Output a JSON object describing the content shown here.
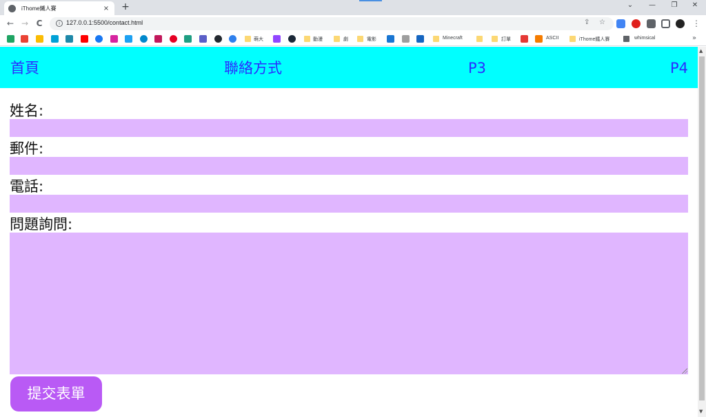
{
  "browser": {
    "tab_title": "iThome鐵人賽",
    "tab_close": "×",
    "new_tab": "+",
    "window_controls": [
      "⌄",
      "—",
      "❐",
      "✕"
    ],
    "nav": {
      "back": "←",
      "forward": "→",
      "reload": "C"
    },
    "url": "127.0.0.1:5500/contact.html",
    "omnibox_icons": [
      "share-icon",
      "star-icon"
    ],
    "menu": "⋮",
    "bookmarks": [
      {
        "label": "萌大"
      },
      {
        "label": "動漫"
      },
      {
        "label": "劇"
      },
      {
        "label": "電影"
      },
      {
        "label": "Minecraft"
      },
      {
        "label": "訂單"
      },
      {
        "label": "ASCII"
      },
      {
        "label": "iThome鐵人賽"
      },
      {
        "label": "whimsical"
      }
    ],
    "bookmarks_more": "»"
  },
  "nav": {
    "home": "首頁",
    "contact": "聯絡方式",
    "p3": "P3",
    "p4": "P4"
  },
  "form": {
    "name_label": "姓名:",
    "email_label": "郵件:",
    "phone_label": "電話:",
    "question_label": "問題詢問:",
    "name_value": "",
    "email_value": "",
    "phone_value": "",
    "question_value": "",
    "submit_label": "提交表單"
  },
  "colors": {
    "navbar": "#00ffff",
    "nav_link": "#2b2bff",
    "input_bg": "#e0b6ff",
    "submit_bg": "#b95af5"
  }
}
